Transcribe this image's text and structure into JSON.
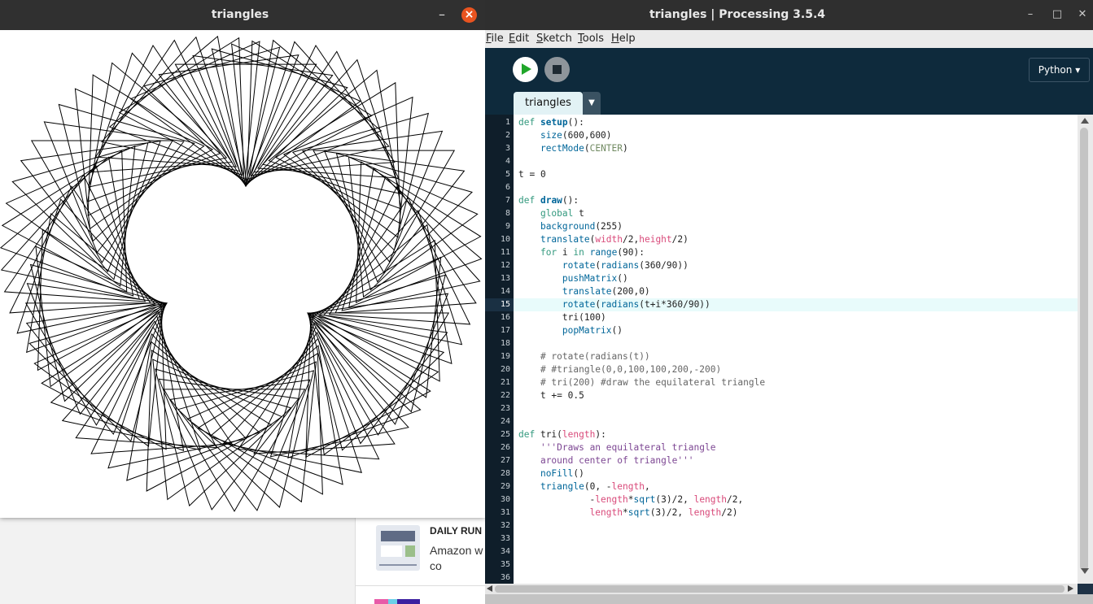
{
  "background_page": {
    "news_kicker": "DAILY RUN",
    "news_text": "Amazon w condo co"
  },
  "sketch_window": {
    "title": "triangles",
    "minimize": "–",
    "close": "×",
    "canvas": {
      "triangle_count": 90,
      "orbit_radius": 200,
      "triangle_size": 100,
      "rotation_t": 0,
      "stroke": "#000000",
      "background": "#ffffff"
    }
  },
  "ide": {
    "title": "triangles | Processing 3.5.4",
    "controls": {
      "minimize": "–",
      "maximize": "□",
      "close": "✕"
    },
    "menu": [
      {
        "mnemonic": "F",
        "rest": "ile"
      },
      {
        "mnemonic": "E",
        "rest": "dit"
      },
      {
        "mnemonic": "S",
        "rest": "ketch"
      },
      {
        "mnemonic": "T",
        "rest": "ools"
      },
      {
        "mnemonic": "H",
        "rest": "elp"
      }
    ],
    "mode": "Python ▾",
    "tab": "triangles",
    "tab_menu": "▼",
    "current_line": 15,
    "colors": {
      "accent_run": "#20a62a",
      "current_line_bg": "#e8fbfb",
      "gutter_bg": "#0f1e2a"
    },
    "code_lines": [
      "def setup():",
      "    size(600,600)",
      "    rectMode(CENTER)",
      "",
      "t = 0",
      "",
      "def draw():",
      "    global t",
      "    background(255)",
      "    translate(width/2,height/2)",
      "    for i in range(90):",
      "        rotate(radians(360/90))",
      "        pushMatrix()",
      "        translate(200,0)",
      "        rotate(radians(t+i*360/90))",
      "        tri(100)",
      "        popMatrix()",
      "",
      "    # rotate(radians(t))",
      "    # #triangle(0,0,100,100,200,-200)",
      "    # tri(200) #draw the equilateral triangle",
      "    t += 0.5",
      "",
      "",
      "def tri(length):",
      "    '''Draws an equilateral triangle",
      "    around center of triangle'''",
      "    noFill()",
      "    triangle(0, -length,",
      "             -length*sqrt(3)/2, length/2,",
      "             length*sqrt(3)/2, length/2)",
      "",
      "",
      "",
      "",
      ""
    ]
  }
}
